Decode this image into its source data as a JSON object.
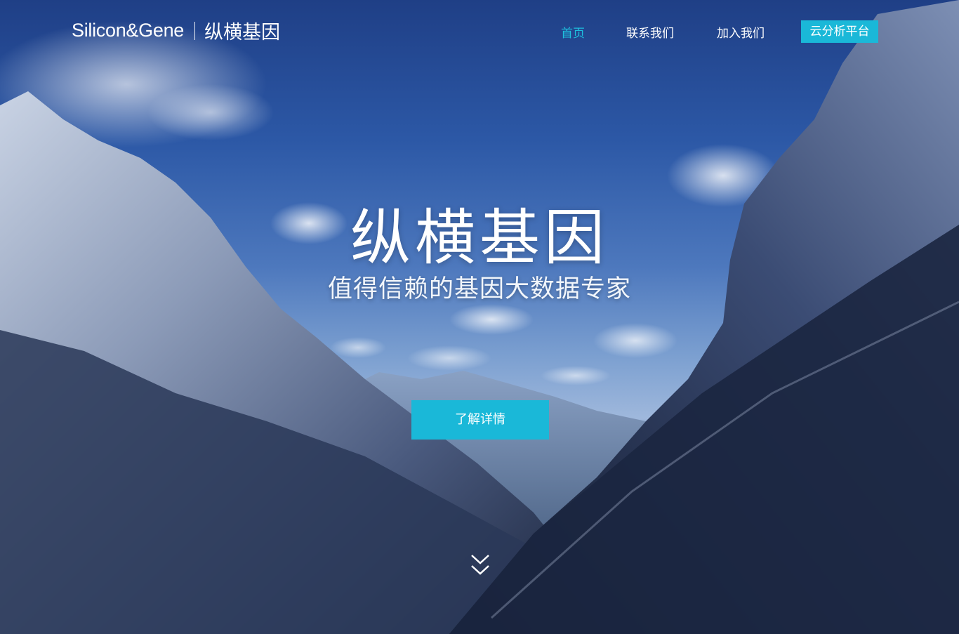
{
  "brand": {
    "logo_en": "Silicon&Gene",
    "logo_cn": "纵横基因"
  },
  "nav": {
    "items": [
      {
        "label": "首页",
        "active": true
      },
      {
        "label": "联系我们",
        "active": false
      },
      {
        "label": "加入我们",
        "active": false
      }
    ],
    "cloud_button": "云分析平台"
  },
  "hero": {
    "title": "纵横基因",
    "subtitle": "值得信赖的基因大数据专家",
    "cta_label": "了解详情",
    "scroll_icon": "double-chevron-down-icon"
  },
  "colors": {
    "accent": "#1ab8d8",
    "nav_active": "#1ec0de",
    "sky": "#2c58a6"
  }
}
